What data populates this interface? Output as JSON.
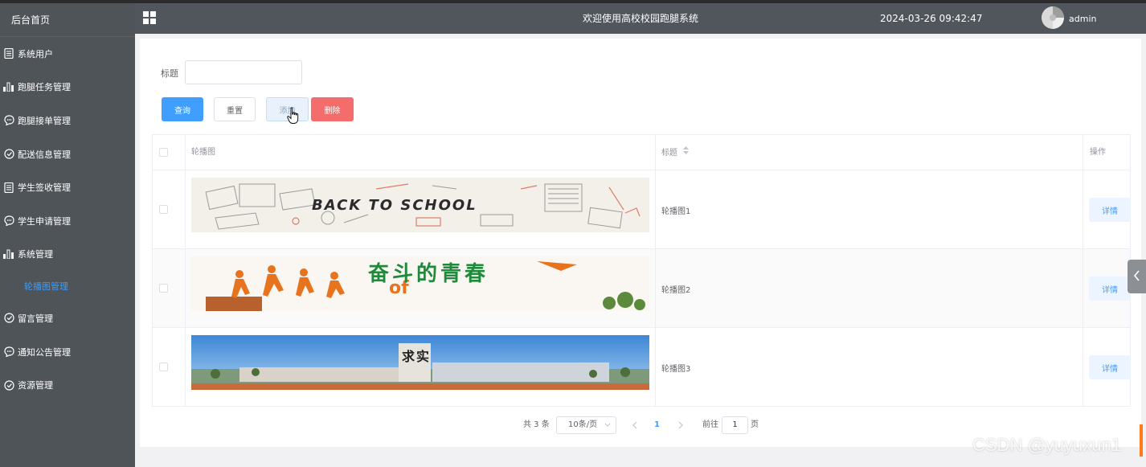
{
  "sidebar": {
    "brand": "后台首页",
    "items": [
      {
        "label": "系统用户",
        "icon": "document-icon"
      },
      {
        "label": "跑腿任务管理",
        "icon": "bar-chart-icon"
      },
      {
        "label": "跑腿接单管理",
        "icon": "chat-bubble-icon"
      },
      {
        "label": "配送信息管理",
        "icon": "check-circle-icon"
      },
      {
        "label": "学生签收管理",
        "icon": "document-icon"
      },
      {
        "label": "学生申请管理",
        "icon": "chat-bubble-icon"
      },
      {
        "label": "系统管理",
        "icon": "bar-chart-icon"
      },
      {
        "label": "留言管理",
        "icon": "check-circle-icon"
      },
      {
        "label": "通知公告管理",
        "icon": "chat-bubble-icon"
      },
      {
        "label": "资源管理",
        "icon": "check-circle-icon"
      }
    ],
    "active_sub": "轮播图管理"
  },
  "header": {
    "title": "欢迎使用高校校园跑腿系统",
    "datetime": "2024-03-26 09:42:47",
    "user": "admin"
  },
  "search": {
    "label": "标题",
    "value": ""
  },
  "toolbar": {
    "query": "查询",
    "reset": "重置",
    "add": "添加",
    "delete": "删除"
  },
  "table": {
    "columns": {
      "image": "轮播图",
      "title": "标题",
      "actions": "操作"
    },
    "rows": [
      {
        "title": "轮播图1",
        "detail": "详情",
        "banner_text": "BACK TO SCHOOL"
      },
      {
        "title": "轮播图2",
        "detail": "详情",
        "banner_text": "奋斗的青春"
      },
      {
        "title": "轮播图3",
        "detail": "详情",
        "banner_text": "求实"
      }
    ]
  },
  "pagination": {
    "total": "共 3 条",
    "page_size": "10条/页",
    "current": "1",
    "goto_label": "前往",
    "goto_value": "1",
    "page_suffix": "页"
  },
  "watermark": "CSDN @yuyuxun1",
  "colors": {
    "primary": "#409eff",
    "danger": "#f56c6c",
    "sidebar": "#4f5459",
    "header": "#50565c"
  }
}
